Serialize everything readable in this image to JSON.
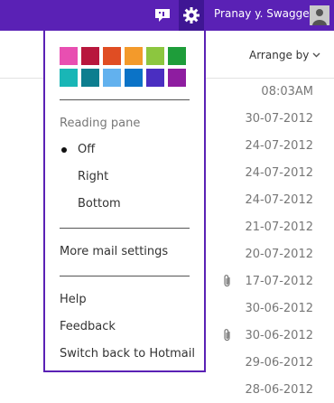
{
  "header": {
    "user_name": "Pranay y. Swagger",
    "brand_color": "#5a21b5"
  },
  "toolbar": {
    "arrange_label": "Arrange by"
  },
  "settings_menu": {
    "theme_colors": [
      "#e84fb1",
      "#b8173d",
      "#e04d23",
      "#f39a2b",
      "#8cc63f",
      "#1e9d3a",
      "#19b6b6",
      "#0d7e8f",
      "#62b1ee",
      "#0b73c7",
      "#4a2ec1",
      "#8e1da0"
    ],
    "reading_pane_heading": "Reading pane",
    "reading_pane_options": [
      "Off",
      "Right",
      "Bottom"
    ],
    "reading_pane_selected": "Off",
    "more_settings": "More mail settings",
    "help": "Help",
    "feedback": "Feedback",
    "switch_back": "Switch back to Hotmail"
  },
  "message_list": {
    "dates": [
      "08:03AM",
      "30-07-2012",
      "24-07-2012",
      "24-07-2012",
      "24-07-2012",
      "21-07-2012",
      "20-07-2012",
      "17-07-2012",
      "30-06-2012",
      "30-06-2012",
      "29-06-2012",
      "28-06-2012"
    ],
    "attachment_rows": [
      7,
      9
    ]
  }
}
